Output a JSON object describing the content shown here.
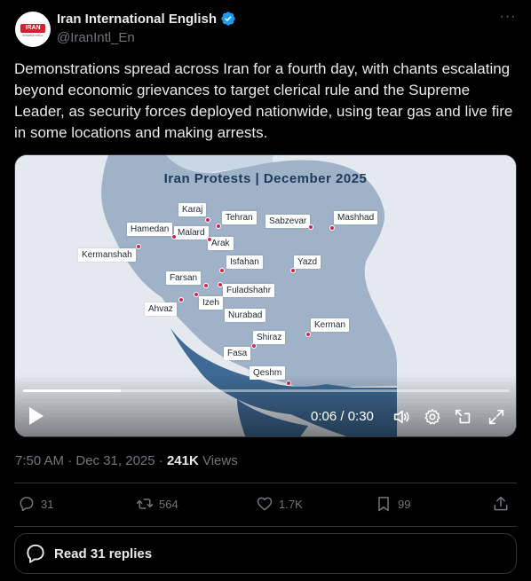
{
  "account": {
    "display_name": "Iran International English",
    "handle": "@IranIntl_En",
    "avatar_logo_text": "IRAN",
    "avatar_logo_sub": "INTERNATIONAL"
  },
  "tweet": {
    "text": "Demonstrations spread across Iran for a fourth day, with chants escalating beyond economic grievances to target clerical rule and the Supreme Leader, as security forces deployed nationwide, using tear gas and live fire in some locations and making arrests."
  },
  "video": {
    "map_title": "Iran Protests | December 2025",
    "time_display": "0:06 / 0:30",
    "progress": 0.2,
    "cities": [
      "Karaj",
      "Tehran",
      "Sabzevar",
      "Mashhad",
      "Hamedan",
      "Malard",
      "Arak",
      "Kermanshah",
      "Isfahan",
      "Yazd",
      "Farsan",
      "Fuladshahr",
      "Ahvaz",
      "Izeh",
      "Nurabad",
      "Kerman",
      "Shiraz",
      "Fasa",
      "Qeshm"
    ]
  },
  "meta": {
    "timestamp": "7:50 AM · Dec 31, 2025 · ",
    "views_count": "241K",
    "views_label": " Views"
  },
  "actions": {
    "replies": "31",
    "reposts": "564",
    "likes": "1.7K",
    "bookmarks": "99"
  },
  "read_replies": "Read 31 replies",
  "colors": {
    "background": "#000000",
    "text": "#e7e9ea",
    "muted": "#71767b",
    "border": "#2f3336",
    "verified": "#1d9bf0",
    "map_land": "#9fb2c7",
    "map_water": "#3f6a94",
    "city_dot": "#d02a4a"
  }
}
